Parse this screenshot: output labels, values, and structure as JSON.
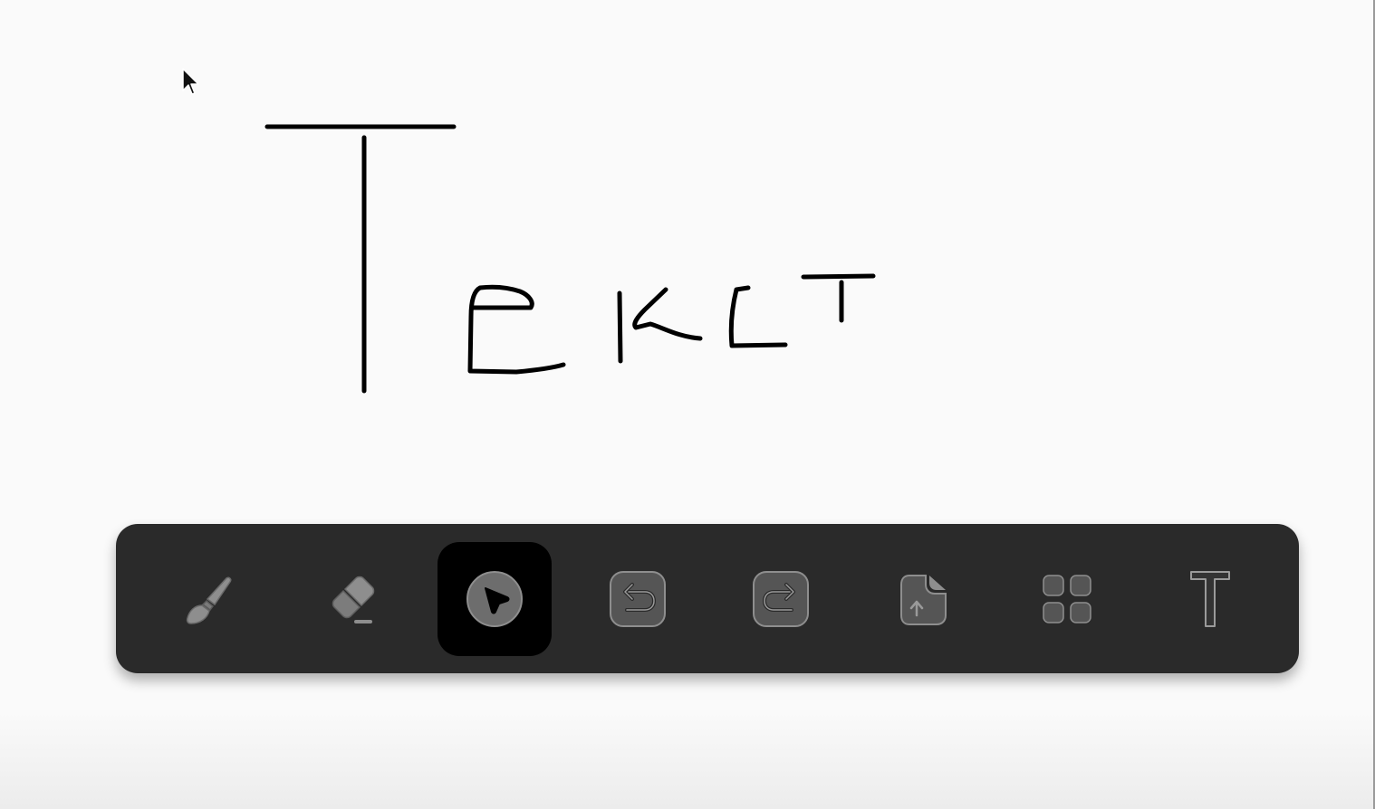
{
  "canvas": {
    "background": "#fafafa",
    "stroke_color": "#000000",
    "handwritten_text": "Tekst"
  },
  "toolbar": {
    "background": "#2a2a2a",
    "active_background": "#000000",
    "icon_color": "#8e8e8e",
    "active_tool": "pointer",
    "tools": [
      {
        "name": "brush",
        "icon": "brush-icon"
      },
      {
        "name": "eraser",
        "icon": "eraser-icon"
      },
      {
        "name": "pointer",
        "icon": "pointer-icon"
      },
      {
        "name": "undo",
        "icon": "undo-icon"
      },
      {
        "name": "redo",
        "icon": "redo-icon"
      },
      {
        "name": "upload-file",
        "icon": "file-upload-icon"
      },
      {
        "name": "apps",
        "icon": "grid-icon"
      },
      {
        "name": "text",
        "icon": "text-icon"
      }
    ]
  }
}
